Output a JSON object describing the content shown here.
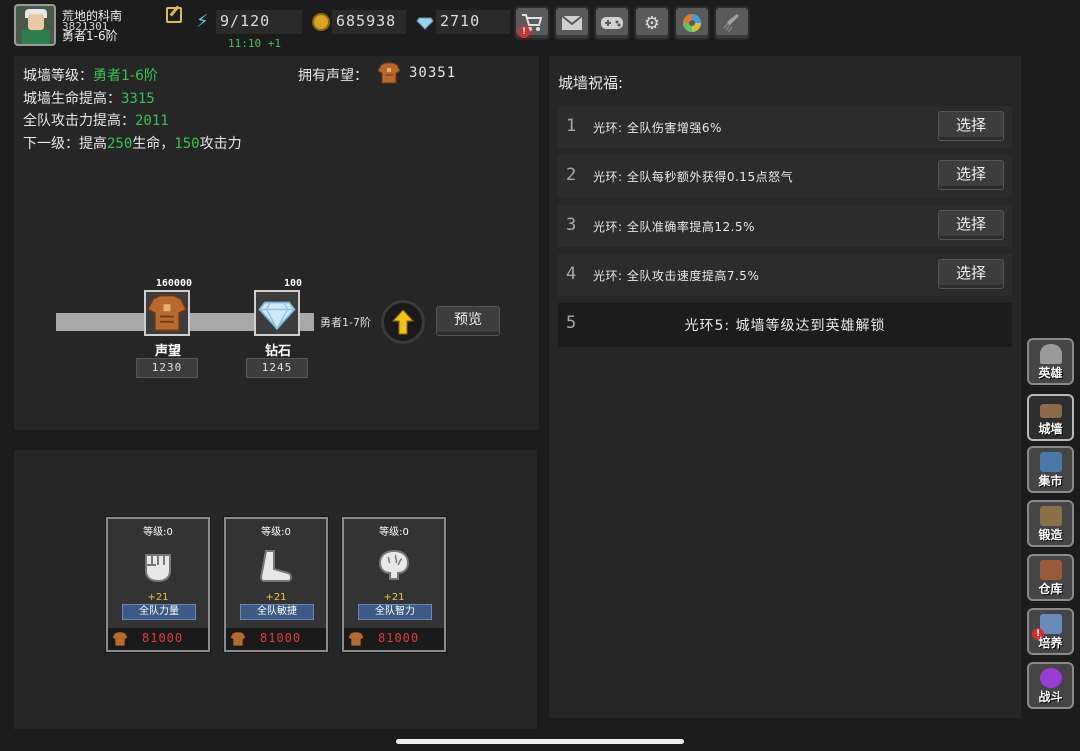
{
  "player": {
    "name": "荒地的科南",
    "id": "3821301",
    "rank": "勇者1-6阶"
  },
  "resources": {
    "energy": "9/120",
    "energy_timer": "11:10 +1",
    "gold": "685938",
    "gems": "2710"
  },
  "toolbar": {
    "items": [
      "shop-cart-icon",
      "mail-icon",
      "gamepad-icon",
      "gear-icon",
      "photo-aperture-icon",
      "rocket-icon"
    ],
    "shop_alert": "!"
  },
  "wall": {
    "level_label": "城墙等级：",
    "level_value": "勇者1-6阶",
    "hp_label": "城墙生命提高：",
    "hp_value": "3315",
    "atk_label": "全队攻击力提高：",
    "atk_value": "2011",
    "next_prefix": "下一级：提高",
    "next_hp": "250",
    "next_mid": "生命，",
    "next_atk": "150",
    "next_suffix": "攻击力",
    "prestige_label": "拥有声望：",
    "prestige_value": "30351",
    "requirements": [
      {
        "need": "160000",
        "label": "声望",
        "have": "1230",
        "icon": "prestige-armor-icon"
      },
      {
        "need": "100",
        "label": "钻石",
        "have": "1245",
        "icon": "diamond-icon"
      }
    ],
    "next_rank": "勇者1-7阶",
    "preview_label": "预览"
  },
  "attributes": [
    {
      "level": "等级:0",
      "bonus": "+21",
      "name": "全队力量",
      "cost": "81000",
      "icon": "fist-icon"
    },
    {
      "level": "等级:0",
      "bonus": "+21",
      "name": "全队敏捷",
      "cost": "81000",
      "icon": "foot-icon"
    },
    {
      "level": "等级:0",
      "bonus": "+21",
      "name": "全队智力",
      "cost": "81000",
      "icon": "brain-icon"
    }
  ],
  "blessings": {
    "title": "城墙祝福:",
    "select_label": "选择",
    "items": [
      {
        "num": "1",
        "text": "光环: 全队伤害增强6%"
      },
      {
        "num": "2",
        "text": "光环: 全队每秒额外获得0.15点怒气"
      },
      {
        "num": "3",
        "text": "光环: 全队准确率提高12.5%"
      },
      {
        "num": "4",
        "text": "光环: 全队攻击速度提高7.5%"
      }
    ],
    "locked": {
      "num": "5",
      "text": "光环5:  城墙等级达到英雄解锁"
    }
  },
  "nav": {
    "hero": "英雄",
    "wall": "城墙",
    "market": "集市",
    "forge": "锻造",
    "storage": "仓库",
    "train": "培养",
    "battle": "战斗",
    "train_alert": "!"
  },
  "colors": {
    "accent_green": "#37c153",
    "cost_red": "#e03a3a",
    "bonus_yellow": "#e8c33a",
    "alert_red": "#d32f2f"
  }
}
